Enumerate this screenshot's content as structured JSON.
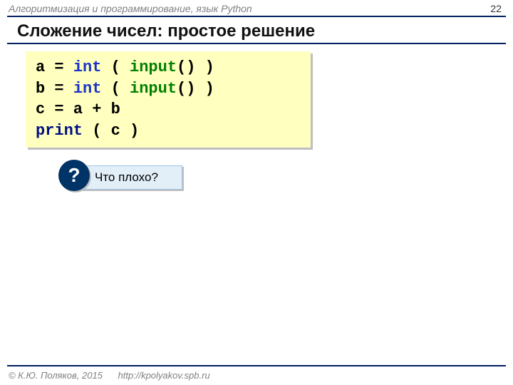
{
  "header": {
    "course": "Алгоритмизация и программирование, язык Python",
    "page": "22"
  },
  "title": "Сложение чисел: простое решение",
  "code": {
    "line1_a": "a",
    "eq": "=",
    "int": "int",
    "line1_rest": "(",
    "input": "input",
    "line1_tail": "() )",
    "line2_a": "b",
    "line3": "c = a + b",
    "print": "print",
    "line4_tail": " ( c )"
  },
  "question": {
    "mark": "?",
    "text": " Что плохо?"
  },
  "footer": {
    "credit": "© К.Ю. Поляков, 2015",
    "url": "http://kpolyakov.spb.ru"
  }
}
